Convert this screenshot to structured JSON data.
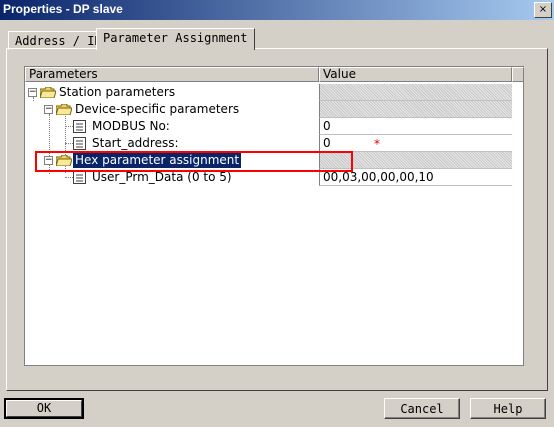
{
  "window": {
    "title": "Properties - DP slave",
    "close_glyph": "×"
  },
  "tabs": [
    {
      "label": "Address / ID"
    },
    {
      "label": "Parameter Assignment"
    }
  ],
  "grid": {
    "columns": {
      "parameters": "Parameters",
      "value": "Value"
    },
    "rows": [
      {
        "name": "Station parameters",
        "value": "",
        "expander": "−"
      },
      {
        "name": "Device-specific parameters",
        "value": "",
        "expander": "−"
      },
      {
        "name": "MODBUS No:",
        "value": "0"
      },
      {
        "name": "Start_address:",
        "value": "0"
      },
      {
        "name": "Hex parameter assignment",
        "value": "",
        "expander": "−"
      },
      {
        "name": "User_Prm_Data (0 to 5)",
        "value": "00,03,00,00,00,10"
      }
    ],
    "required_mark": "*"
  },
  "buttons": {
    "ok": "OK",
    "cancel": "Cancel",
    "help": "Help"
  },
  "colors": {
    "selection": "#0a246a",
    "highlight_box": "#ff0000",
    "title_gradient_start": "#0a246a"
  }
}
